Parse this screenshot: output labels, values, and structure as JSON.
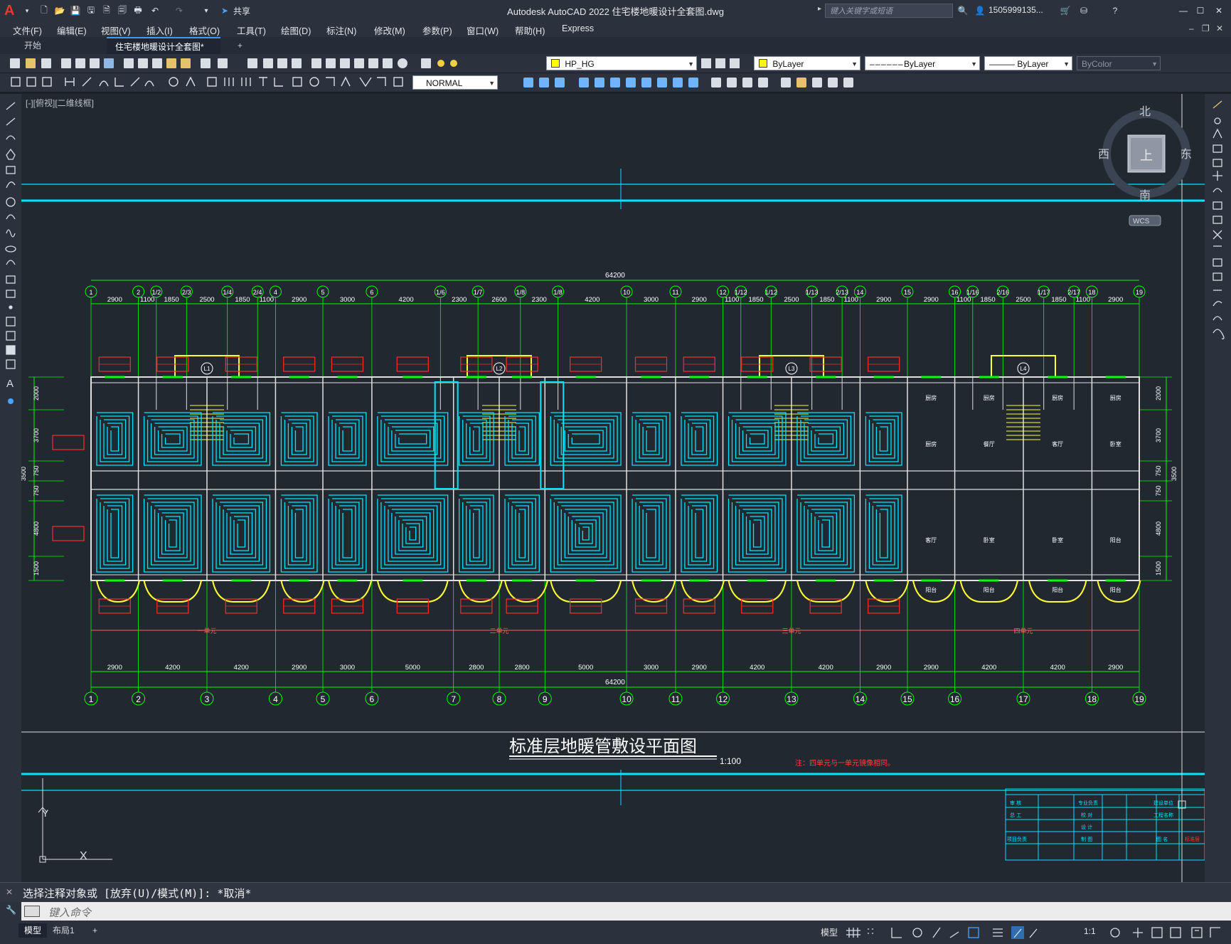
{
  "app": {
    "title": "Autodesk AutoCAD 2022    住宅楼地暖设计全套图.dwg",
    "share_label": "共享",
    "search_placeholder": "键入关键字或短语",
    "user_label": "1505999135...",
    "logo_letter": "A"
  },
  "menu": {
    "items": [
      "文件(F)",
      "编辑(E)",
      "视图(V)",
      "插入(I)",
      "格式(O)",
      "工具(T)",
      "绘图(D)",
      "标注(N)",
      "修改(M)",
      "参数(P)",
      "窗口(W)",
      "帮助(H)",
      "Express"
    ]
  },
  "tabs": {
    "start": "开始",
    "document": "住宅楼地暖设计全套图*",
    "add": "+"
  },
  "toolbar": {
    "layer_name": "HP_HG",
    "color": "ByLayer",
    "linetype": "ByLayer",
    "lineweight": "ByLayer",
    "plotstyle": "ByColor",
    "textstyle": "NORMAL"
  },
  "viewport": {
    "label": "[-][俯视][二维线框]",
    "viewcube": {
      "north": "北",
      "south": "南",
      "east": "东",
      "west": "西",
      "top": "上",
      "wcs": "WCS"
    },
    "ucs": {
      "y": "Y",
      "x": "X"
    }
  },
  "drawing": {
    "title": "标准层地暖管敷设平面图",
    "scale": "1:100",
    "note": "注：四单元与一单元镜像相同。",
    "total_dimension": "64200",
    "top_axes": [
      "1",
      "2",
      "1/2",
      "2/3",
      "1/4",
      "2/4",
      "4",
      "5",
      "6",
      "1/6",
      "1/7",
      "1/8",
      "1/8",
      "10",
      "11",
      "12",
      "1/12",
      "1/12",
      "1/13",
      "2/13",
      "14",
      "15",
      "16",
      "1/16",
      "2/16",
      "1/17",
      "2/17",
      "18",
      "19"
    ],
    "top_dims": [
      "2900",
      "1100",
      "1850",
      "2500",
      "1850",
      "1100",
      "2900",
      "3000",
      "4200",
      "2300",
      "2600",
      "2300",
      "4200",
      "3000",
      "2900",
      "1100",
      "1850",
      "2500",
      "1850",
      "1100",
      "2900",
      "2900",
      "1100",
      "1850",
      "2500",
      "1850",
      "1100",
      "2900"
    ],
    "bottom_axes": [
      "1",
      "2",
      "3",
      "4",
      "5",
      "6",
      "7",
      "8",
      "9",
      "10",
      "11",
      "12",
      "13",
      "14",
      "15",
      "16",
      "17",
      "18",
      "19"
    ],
    "bottom_dims": [
      "2900",
      "4200",
      "4200",
      "2900",
      "3000",
      "5000",
      "2800",
      "2800",
      "5000",
      "3000",
      "2900",
      "4200",
      "4200",
      "2900",
      "2900",
      "4200",
      "4200",
      "2900"
    ],
    "units": [
      "一单元",
      "二单元",
      "三单元",
      "四单元"
    ],
    "left_dims": [
      "2000",
      "3700",
      "750",
      "750",
      "4800",
      "1500"
    ],
    "left_dim_total": "3500",
    "right_dims": [
      "2000",
      "3700",
      "750",
      "750",
      "4800",
      "1500"
    ],
    "right_dim_total": "3500",
    "room_labels": [
      "厨房",
      "餐厅",
      "客厅",
      "卧室",
      "卧室",
      "阳台"
    ],
    "stair_tags": [
      "L1",
      "L2",
      "L3",
      "L4"
    ],
    "titleblock": {
      "cells": [
        "审 核",
        "总 工",
        "项目负责",
        "专业负责",
        "校 对",
        "设 计",
        "制 图",
        "建设单位",
        "工程名称",
        "图 名",
        "标准层"
      ]
    }
  },
  "command": {
    "history": "选择注释对象或 [放弃(U)/模式(M)]: *取消*",
    "placeholder": "键入命令"
  },
  "statusbar": {
    "model_tab": "模型",
    "layout_tab": "布局1",
    "add": "+",
    "model_button": "模型",
    "scale": "1:1"
  },
  "colors": {
    "background": "#212830",
    "pipe": "#00e5ff",
    "wall": "#e0e0e0",
    "axis": "#00ff00",
    "dimension_red": "#ff2a2a",
    "stair": "#ffff33",
    "frame_cyan": "#00e5ff"
  }
}
